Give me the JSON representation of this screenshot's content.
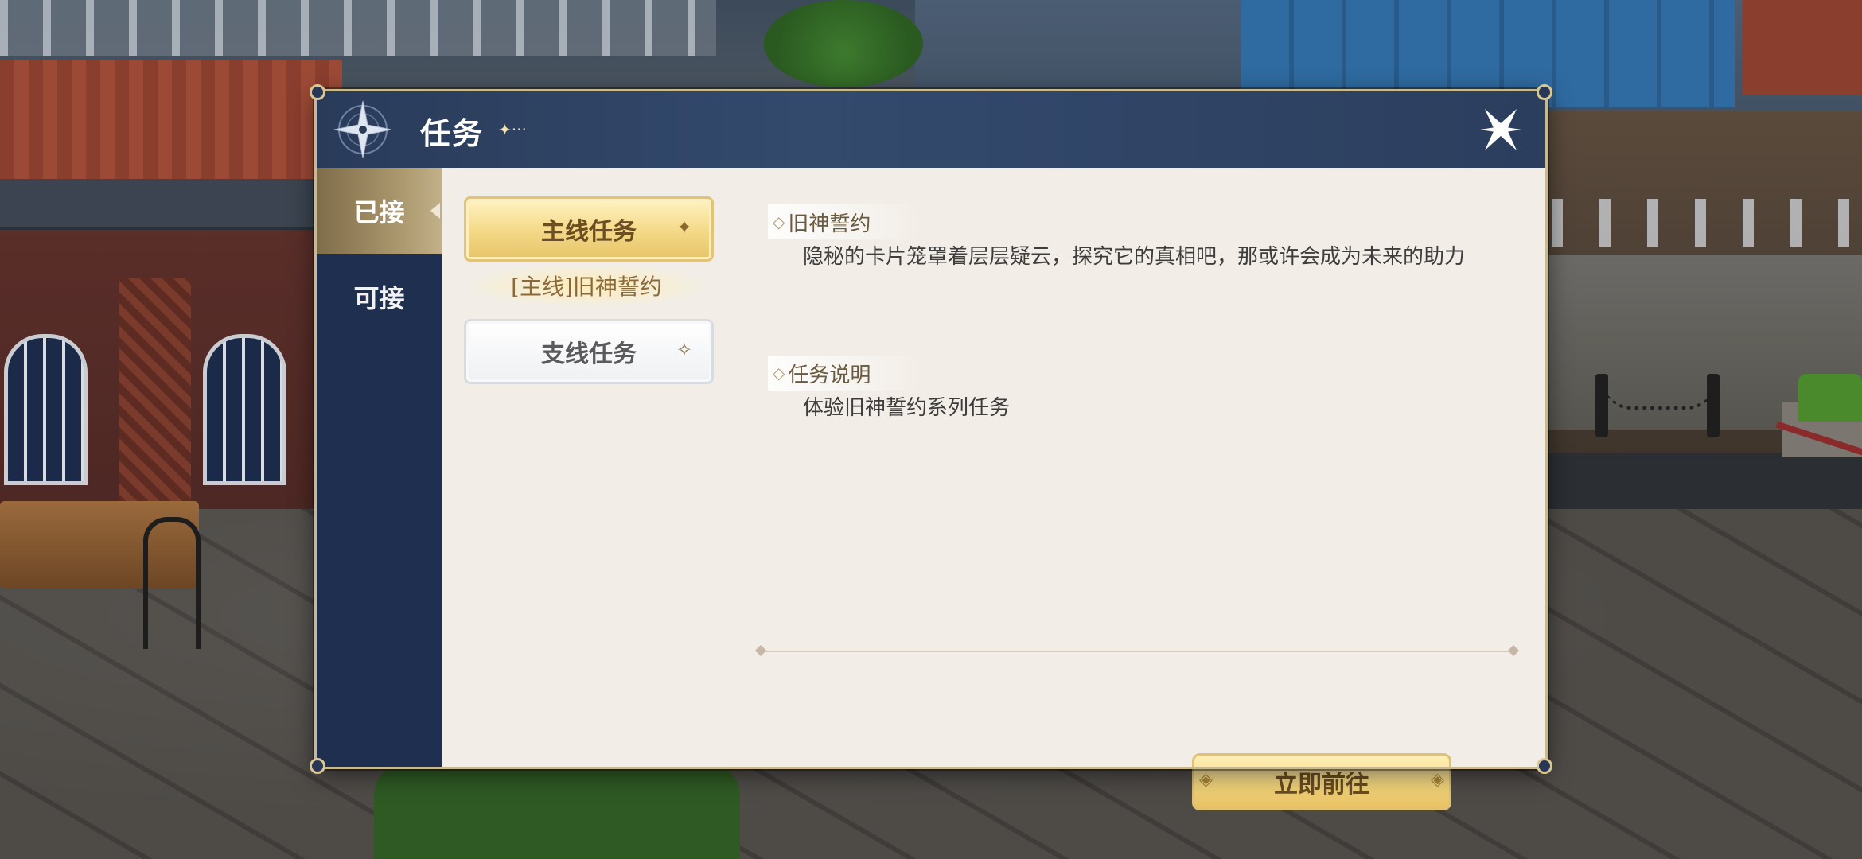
{
  "dialog": {
    "title": "任务",
    "title_decoration": "✦···",
    "close_icon": "close-x-icon"
  },
  "sidebar": {
    "tabs": [
      {
        "label": "已接",
        "active": true
      },
      {
        "label": "可接",
        "active": false
      }
    ]
  },
  "quest_list": {
    "main_category": "主线任务",
    "main_items": [
      "[主线]旧神誓约"
    ],
    "side_category": "支线任务"
  },
  "detail": {
    "name_header": "旧神誓约",
    "description": "隐秘的卡片笼罩着层层疑云，探究它的真相吧，那或许会成为未来的助力",
    "info_header": "任务说明",
    "info_text": "体验旧神誓约系列任务",
    "go_button": "立即前往"
  },
  "colors": {
    "titlebar": "#2f4466",
    "sidebar": "#1f2f50",
    "content_bg": "#f2eee7",
    "gold_button": "#f4d886",
    "frame": "#c9b98f"
  }
}
